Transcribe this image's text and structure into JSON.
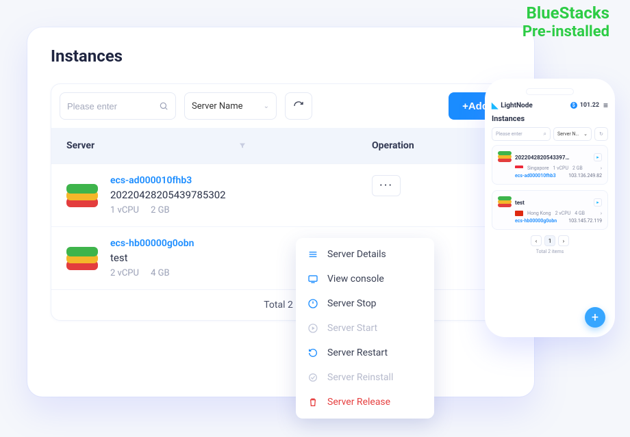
{
  "corner": {
    "line1": "BlueStacks",
    "line2": "Pre-installed"
  },
  "page_title": "Instances",
  "filter": {
    "search_placeholder": "Please enter",
    "select_label": "Server Name",
    "add_label": "+Add"
  },
  "table": {
    "header": {
      "server": "Server",
      "operation": "Operation"
    },
    "rows": [
      {
        "name": "ecs-ad000010fhb3",
        "sub": "20220428205439785302",
        "cpu": "1 vCPU",
        "ram": "2 GB"
      },
      {
        "name": "ecs-hb00000g0obn",
        "sub": "test",
        "cpu": "2 vCPU",
        "ram": "4 GB"
      }
    ],
    "footer": "Total 2 i"
  },
  "menu": [
    {
      "label": "Server Details",
      "state": "enabled",
      "icon": "details-icon"
    },
    {
      "label": "View console",
      "state": "enabled",
      "icon": "console-icon"
    },
    {
      "label": "Server Stop",
      "state": "enabled",
      "icon": "stop-icon"
    },
    {
      "label": "Server Start",
      "state": "disabled",
      "icon": "start-icon"
    },
    {
      "label": "Server Restart",
      "state": "enabled",
      "icon": "restart-icon"
    },
    {
      "label": "Server Reinstall",
      "state": "disabled",
      "icon": "reinstall-icon"
    },
    {
      "label": "Server Release",
      "state": "danger",
      "icon": "release-icon"
    }
  ],
  "phone": {
    "brand": "LightNode",
    "balance": "101.22",
    "title": "Instances",
    "search_placeholder": "Please enter",
    "select_label": "Server N…",
    "cards": [
      {
        "name": "2022042820543397…",
        "region": "Singapore",
        "flag": "sg",
        "cpu": "1 vCPU",
        "ram": "2 GB",
        "ecs": "ecs-ad000010fhb3",
        "ip": "103.136.249.82"
      },
      {
        "name": "test",
        "region": "Hong Kong",
        "flag": "hk",
        "cpu": "2 vCPU",
        "ram": "4 GB",
        "ecs": "ecs-hb00000g0obn",
        "ip": "103.145.72.119"
      }
    ],
    "pager_total": "Total 2 items"
  }
}
